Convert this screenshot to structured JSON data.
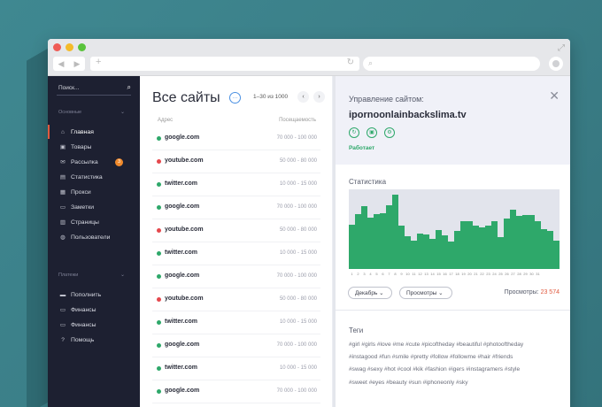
{
  "chrome": {
    "nav_back": "◀",
    "nav_fwd": "▶",
    "new_tab": "+",
    "reload": "↻"
  },
  "sidebar": {
    "search_label": "Поиск...",
    "section_main": "Основные",
    "items": [
      {
        "label": "Главная",
        "icon": "home-icon",
        "glyph": "⌂"
      },
      {
        "label": "Товары",
        "icon": "box-icon",
        "glyph": "▣"
      },
      {
        "label": "Рассылка",
        "icon": "mail-icon",
        "glyph": "✉",
        "badge": "3"
      },
      {
        "label": "Статистика",
        "icon": "stats-icon",
        "glyph": "▤"
      },
      {
        "label": "Прокси",
        "icon": "proxy-icon",
        "glyph": "▦"
      },
      {
        "label": "Заметки",
        "icon": "notes-icon",
        "glyph": "▭"
      },
      {
        "label": "Страницы",
        "icon": "pages-icon",
        "glyph": "▥"
      },
      {
        "label": "Пользователи",
        "icon": "user-icon",
        "glyph": "◍"
      }
    ],
    "section_payments": "Платежи",
    "items2": [
      {
        "label": "Пополнить",
        "icon": "wallet-icon",
        "glyph": "▬"
      },
      {
        "label": "Финансы",
        "icon": "card-icon",
        "glyph": "▭"
      },
      {
        "label": "Финансы",
        "icon": "card-icon",
        "glyph": "▭"
      },
      {
        "label": "Помощь",
        "icon": "help-icon",
        "glyph": "?"
      }
    ]
  },
  "list": {
    "title": "Все сайты",
    "pager": "1–30 из 1000",
    "col_address": "Адрес",
    "col_attendance": "Посещаемость",
    "rows": [
      {
        "site": "google.com",
        "range": "70 000 - 100 000",
        "status_color": "#2ea86a"
      },
      {
        "site": "youtube.com",
        "range": "50 000 - 80 000",
        "status_color": "#e5484d"
      },
      {
        "site": "twitter.com",
        "range": "10 000 - 15 000",
        "status_color": "#2ea86a"
      },
      {
        "site": "google.com",
        "range": "70 000 - 100 000",
        "status_color": "#2ea86a"
      },
      {
        "site": "youtube.com",
        "range": "50 000 - 80 000",
        "status_color": "#e5484d"
      },
      {
        "site": "twitter.com",
        "range": "10 000 - 15 000",
        "status_color": "#2ea86a"
      },
      {
        "site": "google.com",
        "range": "70 000 - 100 000",
        "status_color": "#2ea86a"
      },
      {
        "site": "youtube.com",
        "range": "50 000 - 80 000",
        "status_color": "#e5484d"
      },
      {
        "site": "twitter.com",
        "range": "10 000 - 15 000",
        "status_color": "#2ea86a"
      },
      {
        "site": "google.com",
        "range": "70 000 - 100 000",
        "status_color": "#2ea86a"
      },
      {
        "site": "twitter.com",
        "range": "10 000 - 15 000",
        "status_color": "#2ea86a"
      },
      {
        "site": "google.com",
        "range": "70 000 - 100 000",
        "status_color": "#2ea86a"
      }
    ]
  },
  "detail": {
    "subtitle": "Управление сайтом:",
    "domain": "ipornoonlainbackslima.tv",
    "status": "Работает",
    "stats_title": "Статистика",
    "month_select": "Декабрь ⌄",
    "metric_select": "Просмотры ⌄",
    "views_label": "Просмотры:",
    "views_value": "23 574",
    "tags_title": "Теги",
    "tags_lines": [
      "#girl #girls #love #me #cute #picoftheday #beautiful #photooftheday",
      "#instagood #fun #smile #pretty #follow #followme #hair #friends",
      "#swag #sexy #hot #cool #kik #fashion #igers #instagramers #style",
      "#sweet #eyes #beauty #sun #iphoneonly #sky"
    ],
    "chart_days": [
      "1",
      "2",
      "3",
      "4",
      "5",
      "6",
      "7",
      "8",
      "9",
      "10",
      "11",
      "12",
      "13",
      "14",
      "15",
      "16",
      "17",
      "18",
      "19",
      "20",
      "21",
      "22",
      "23",
      "24",
      "25",
      "26",
      "27",
      "28",
      "29",
      "30",
      "31"
    ],
    "chart_values": [
      0.56,
      0.69,
      0.79,
      0.64,
      0.69,
      0.7,
      0.8,
      0.93,
      0.55,
      0.41,
      0.36,
      0.44,
      0.43,
      0.38,
      0.49,
      0.42,
      0.34,
      0.48,
      0.6,
      0.6,
      0.55,
      0.52,
      0.55,
      0.6,
      0.4,
      0.63,
      0.75,
      0.67,
      0.68,
      0.68,
      0.6,
      0.5,
      0.48,
      0.36
    ],
    "accent": "#2ea86a",
    "alert": "#e0593e"
  }
}
